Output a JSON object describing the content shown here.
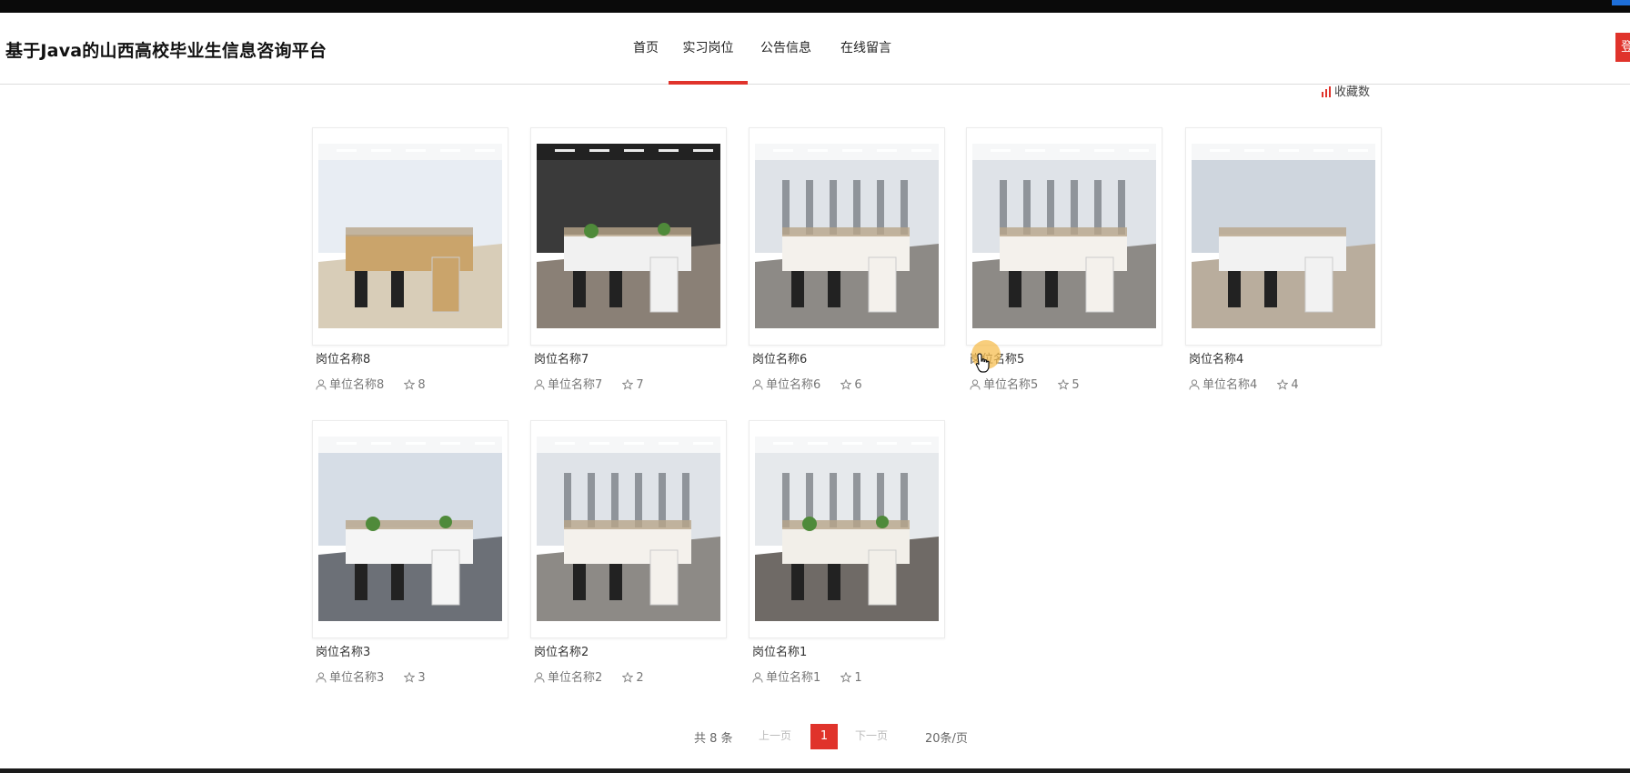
{
  "site": {
    "title": "基于Java的山西高校毕业生信息咨询平台"
  },
  "nav": [
    {
      "label": "首页",
      "active": false
    },
    {
      "label": "实习岗位",
      "active": true
    },
    {
      "label": "公告信息",
      "active": false
    },
    {
      "label": "在线留言",
      "active": false
    }
  ],
  "header": {
    "login_label": "登"
  },
  "sort": {
    "label": "收藏数"
  },
  "cards": [
    {
      "title": "岗位名称8",
      "company": "单位名称8",
      "favorites": "8",
      "scene": "light"
    },
    {
      "title": "岗位名称7",
      "company": "单位名称7",
      "favorites": "7",
      "scene": "dark"
    },
    {
      "title": "岗位名称6",
      "company": "单位名称6",
      "favorites": "6",
      "scene": "rows"
    },
    {
      "title": "岗位名称5",
      "company": "单位名称5",
      "favorites": "5",
      "scene": "rows"
    },
    {
      "title": "岗位名称4",
      "company": "单位名称4",
      "favorites": "4",
      "scene": "cubicle"
    },
    {
      "title": "岗位名称3",
      "company": "单位名称3",
      "favorites": "3",
      "scene": "open"
    },
    {
      "title": "岗位名称2",
      "company": "单位名称2",
      "favorites": "2",
      "scene": "rows"
    },
    {
      "title": "岗位名称1",
      "company": "单位名称1",
      "favorites": "1",
      "scene": "green"
    }
  ],
  "pagination": {
    "total": "共 8 条",
    "prev": "上一页",
    "current": "1",
    "next": "下一页",
    "page_size": "20条/页"
  },
  "colors": {
    "accent": "#e0332b"
  }
}
